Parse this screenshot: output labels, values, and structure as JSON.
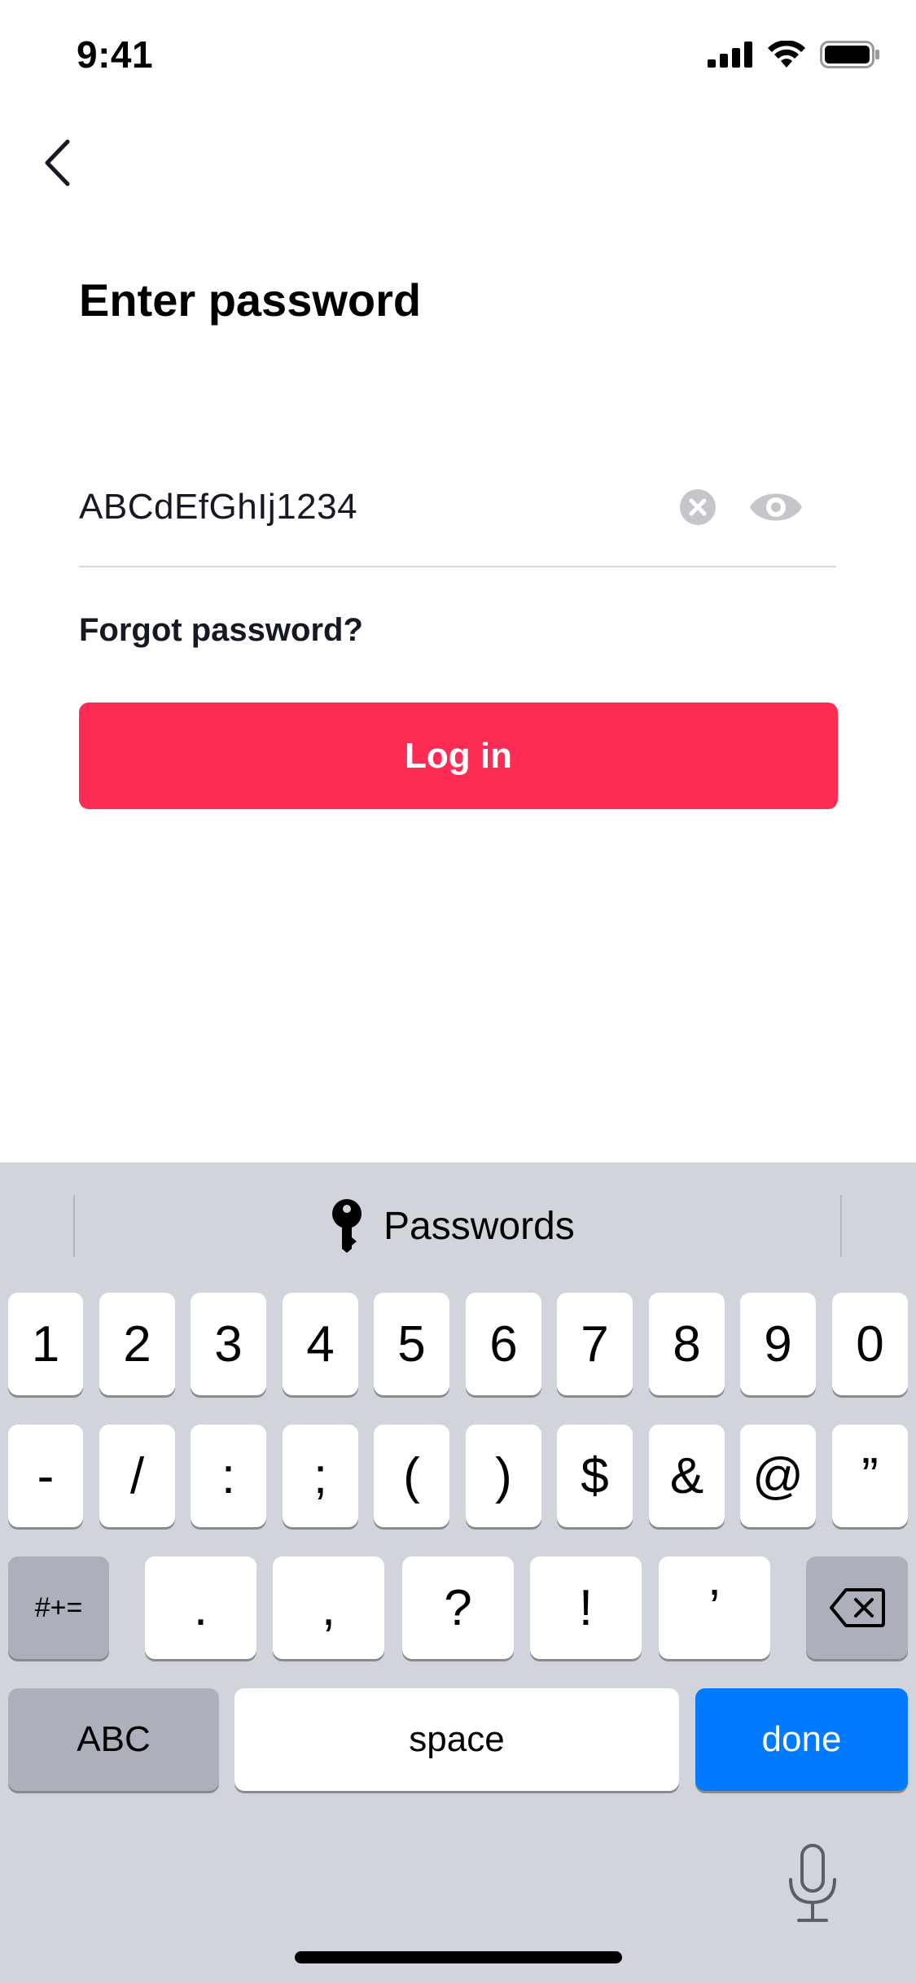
{
  "status_bar": {
    "time": "9:41"
  },
  "header": {
    "title": "Enter password"
  },
  "password_field": {
    "value": "ABCdEfGhIj1234"
  },
  "forgot_link": "Forgot password?",
  "login_button": "Log in",
  "colors": {
    "accent": "#fe2c55",
    "keyboard_bg": "#d1d4db",
    "done_key": "#007aff"
  },
  "keyboard": {
    "suggestion": "Passwords",
    "row1": [
      "1",
      "2",
      "3",
      "4",
      "5",
      "6",
      "7",
      "8",
      "9",
      "0"
    ],
    "row2": [
      "-",
      "/",
      ":",
      ";",
      "(",
      ")",
      "$",
      "&",
      "@",
      "”"
    ],
    "row3": [
      "#+=",
      ".",
      ",",
      "?",
      "!",
      "’"
    ],
    "abc": "ABC",
    "space": "space",
    "done": "done"
  }
}
